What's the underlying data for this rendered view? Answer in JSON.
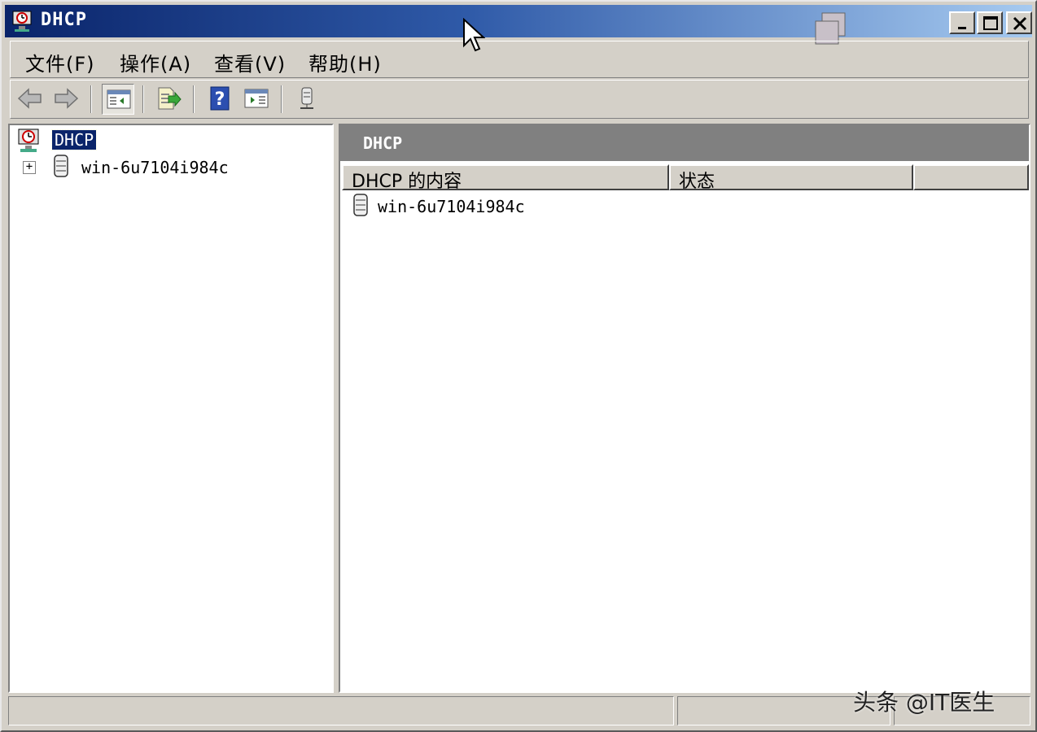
{
  "window": {
    "title": "DHCP"
  },
  "menu": {
    "items": [
      {
        "label": "文件",
        "accel": "(F)"
      },
      {
        "label": "操作",
        "accel": "(A)"
      },
      {
        "label": "查看",
        "accel": "(V)"
      },
      {
        "label": "帮助",
        "accel": "(H)"
      }
    ]
  },
  "toolbar": {
    "buttons": [
      "back-icon",
      "forward-icon",
      "show-hide-console-tree-icon",
      "export-list-icon",
      "help-icon",
      "show-hide-action-pane-icon",
      "server-status-icon"
    ]
  },
  "tree": {
    "root_label": "DHCP",
    "node_expander": "+",
    "node_label": "win-6u7104i984c"
  },
  "details": {
    "header_title": "DHCP",
    "columns": [
      "DHCP 的内容",
      "状态",
      ""
    ],
    "rows": [
      {
        "name": "win-6u7104i984c",
        "status": ""
      }
    ]
  },
  "watermark": "头条 @IT医生",
  "colors": {
    "title_bar_start": "#0a246a",
    "title_bar_end": "#a6caf0",
    "selection": "#0a246a",
    "details_header": "#808080",
    "chrome": "#d4d0c8"
  }
}
